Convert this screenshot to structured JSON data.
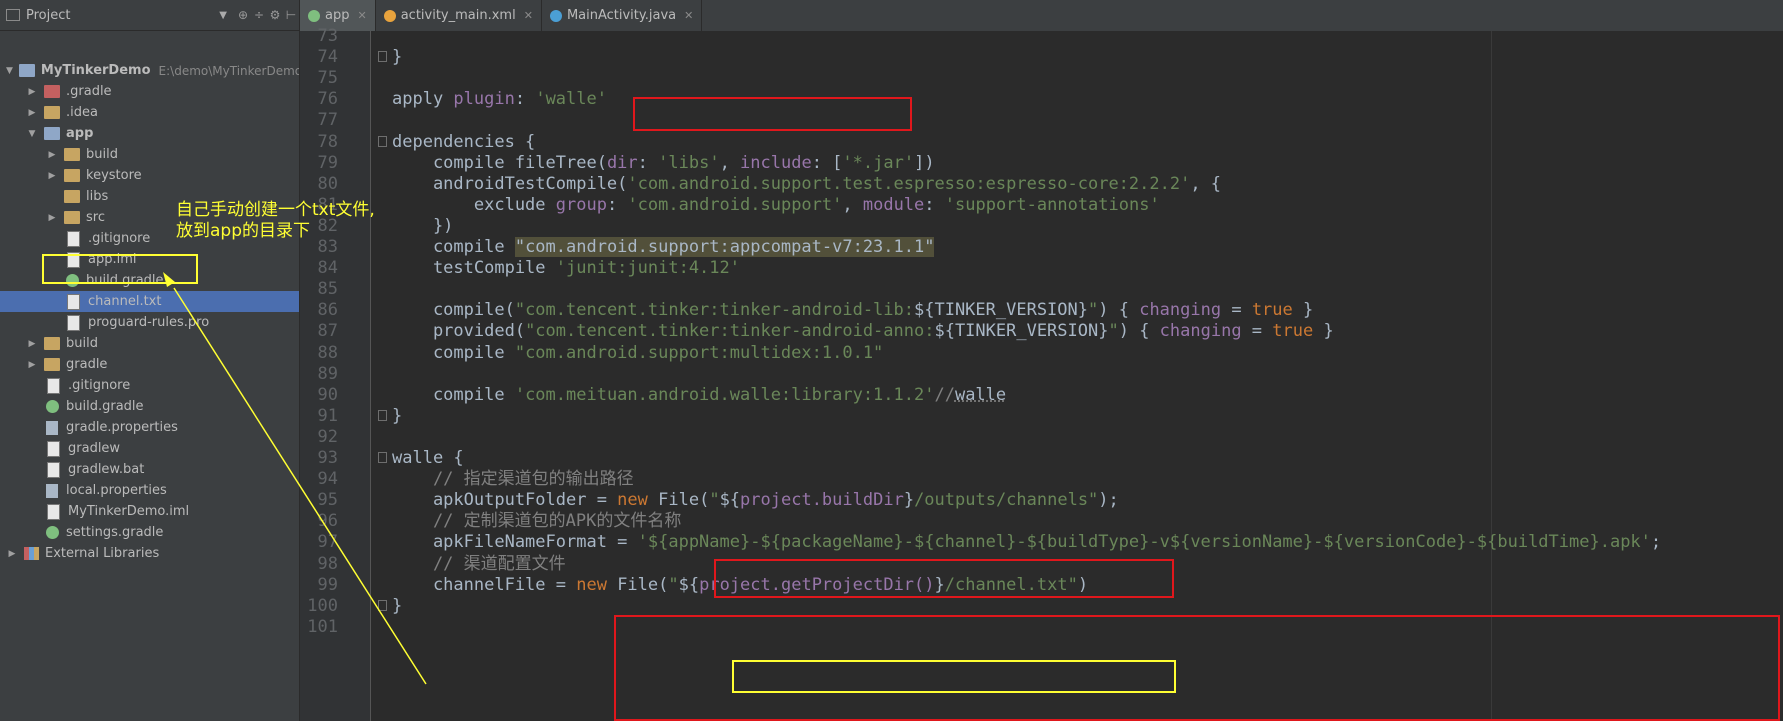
{
  "sidebar": {
    "header_label": "Project",
    "tree": [
      {
        "label": "MyTinkerDemo",
        "hint": "E:\\demo\\MyTinkerDemo",
        "depth": 0,
        "arrow": "open",
        "icon": "module-folder-icon",
        "bold": true
      },
      {
        "label": ".gradle",
        "depth": 1,
        "arrow": "closed",
        "icon": "excluded-folder-icon"
      },
      {
        "label": ".idea",
        "depth": 1,
        "arrow": "closed",
        "icon": "folder-icon"
      },
      {
        "label": "app",
        "depth": 1,
        "arrow": "open",
        "icon": "module-folder-icon",
        "bold": true
      },
      {
        "label": "build",
        "depth": 2,
        "arrow": "closed",
        "icon": "folder-icon"
      },
      {
        "label": "keystore",
        "depth": 2,
        "arrow": "closed",
        "icon": "folder-icon"
      },
      {
        "label": "libs",
        "depth": 2,
        "arrow": "none",
        "icon": "folder-icon"
      },
      {
        "label": "src",
        "depth": 2,
        "arrow": "closed",
        "icon": "folder-icon"
      },
      {
        "label": ".gitignore",
        "depth": 2,
        "arrow": "none",
        "icon": "file-icon"
      },
      {
        "label": "app.iml",
        "depth": 2,
        "arrow": "none",
        "icon": "file-icon"
      },
      {
        "label": "build.gradle",
        "depth": 2,
        "arrow": "none",
        "icon": "gradle-icon"
      },
      {
        "label": "channel.txt",
        "depth": 2,
        "arrow": "none",
        "icon": "file-icon",
        "selected": true
      },
      {
        "label": "proguard-rules.pro",
        "depth": 2,
        "arrow": "none",
        "icon": "file-icon"
      },
      {
        "label": "build",
        "depth": 1,
        "arrow": "closed",
        "icon": "folder-icon"
      },
      {
        "label": "gradle",
        "depth": 1,
        "arrow": "closed",
        "icon": "folder-icon"
      },
      {
        "label": ".gitignore",
        "depth": 1,
        "arrow": "none",
        "icon": "file-icon"
      },
      {
        "label": "build.gradle",
        "depth": 1,
        "arrow": "none",
        "icon": "gradle-icon"
      },
      {
        "label": "gradle.properties",
        "depth": 1,
        "arrow": "none",
        "icon": "properties-icon"
      },
      {
        "label": "gradlew",
        "depth": 1,
        "arrow": "none",
        "icon": "file-icon"
      },
      {
        "label": "gradlew.bat",
        "depth": 1,
        "arrow": "none",
        "icon": "file-icon"
      },
      {
        "label": "local.properties",
        "depth": 1,
        "arrow": "none",
        "icon": "properties-icon"
      },
      {
        "label": "MyTinkerDemo.iml",
        "depth": 1,
        "arrow": "none",
        "icon": "file-icon"
      },
      {
        "label": "settings.gradle",
        "depth": 1,
        "arrow": "none",
        "icon": "gradle-icon"
      },
      {
        "label": "External Libraries",
        "depth": 0,
        "arrow": "closed",
        "icon": "libraries-icon"
      }
    ]
  },
  "tabs": [
    {
      "label": "app",
      "icon_color": "#7fbf7f",
      "active": true
    },
    {
      "label": "activity_main.xml",
      "icon_color": "#e8a33d",
      "active": false
    },
    {
      "label": "MainActivity.java",
      "icon_color": "#4b9fd5",
      "active": false
    }
  ],
  "annotation_text": "自己手动创建一个txt文件,\n放到app的目录下",
  "code_lines": [
    {
      "n": "73",
      "fold": false,
      "parts": []
    },
    {
      "n": "74",
      "fold": true,
      "parts": [
        [
          "p",
          "}"
        ]
      ]
    },
    {
      "n": "75",
      "fold": false,
      "parts": []
    },
    {
      "n": "76",
      "fold": false,
      "parts": [
        [
          "p",
          "apply "
        ],
        [
          "prop",
          "plugin"
        ],
        [
          "p",
          ": "
        ],
        [
          "str",
          "'walle'"
        ]
      ]
    },
    {
      "n": "77",
      "fold": false,
      "parts": []
    },
    {
      "n": "78",
      "fold": true,
      "parts": [
        [
          "p",
          "dependencies {"
        ]
      ]
    },
    {
      "n": "79",
      "fold": false,
      "parts": [
        [
          "p",
          "    compile fileTree("
        ],
        [
          "prop",
          "dir"
        ],
        [
          "p",
          ": "
        ],
        [
          "str",
          "'libs'"
        ],
        [
          "p",
          ", "
        ],
        [
          "prop",
          "include"
        ],
        [
          "p",
          ": ["
        ],
        [
          "str",
          "'*.jar'"
        ],
        [
          "p",
          "])"
        ]
      ]
    },
    {
      "n": "80",
      "fold": false,
      "parts": [
        [
          "p",
          "    androidTestCompile("
        ],
        [
          "str",
          "'com.android.support.test.espresso:espresso-core:2.2.2'"
        ],
        [
          "p",
          ", {"
        ]
      ]
    },
    {
      "n": "81",
      "fold": false,
      "parts": [
        [
          "p",
          "        exclude "
        ],
        [
          "prop",
          "group"
        ],
        [
          "p",
          ": "
        ],
        [
          "str",
          "'com.android.support'"
        ],
        [
          "p",
          ", "
        ],
        [
          "prop",
          "module"
        ],
        [
          "p",
          ": "
        ],
        [
          "str",
          "'support-annotations'"
        ]
      ]
    },
    {
      "n": "82",
      "fold": false,
      "parts": [
        [
          "p",
          "    })"
        ]
      ]
    },
    {
      "n": "83",
      "fold": false,
      "parts": [
        [
          "p",
          "    compile "
        ],
        [
          "hl",
          "\"com.android.support:appcompat-v7:23.1.1\""
        ]
      ]
    },
    {
      "n": "84",
      "fold": false,
      "parts": [
        [
          "p",
          "    testCompile "
        ],
        [
          "str",
          "'junit:junit:4.12'"
        ]
      ]
    },
    {
      "n": "85",
      "fold": false,
      "parts": []
    },
    {
      "n": "86",
      "fold": false,
      "parts": [
        [
          "p",
          "    compile("
        ],
        [
          "str",
          "\"com.tencent.tinker:tinker-android-lib:"
        ],
        [
          "p",
          "${TINKER_VERSION}"
        ],
        [
          "str",
          "\""
        ],
        [
          "p",
          ") { "
        ],
        [
          "prop",
          "changing"
        ],
        [
          "p",
          " = "
        ],
        [
          "kw",
          "true"
        ],
        [
          "p",
          " }"
        ]
      ]
    },
    {
      "n": "87",
      "fold": false,
      "parts": [
        [
          "p",
          "    provided("
        ],
        [
          "str",
          "\"com.tencent.tinker:tinker-android-anno:"
        ],
        [
          "p",
          "${TINKER_VERSION}"
        ],
        [
          "str",
          "\""
        ],
        [
          "p",
          ") { "
        ],
        [
          "prop",
          "changing"
        ],
        [
          "p",
          " = "
        ],
        [
          "kw",
          "true"
        ],
        [
          "p",
          " }"
        ]
      ]
    },
    {
      "n": "88",
      "fold": false,
      "parts": [
        [
          "p",
          "    compile "
        ],
        [
          "str",
          "\"com.android.support:multidex:1.0.1\""
        ]
      ]
    },
    {
      "n": "89",
      "fold": false,
      "parts": []
    },
    {
      "n": "90",
      "fold": false,
      "parts": [
        [
          "p",
          "    compile "
        ],
        [
          "str",
          "'com.meituan.android.walle:library:1.1.2'"
        ],
        [
          "cmt",
          "//"
        ],
        [
          "wavy",
          "walle"
        ]
      ]
    },
    {
      "n": "91",
      "fold": true,
      "parts": [
        [
          "p",
          "}"
        ]
      ]
    },
    {
      "n": "92",
      "fold": false,
      "parts": []
    },
    {
      "n": "93",
      "fold": true,
      "parts": [
        [
          "p",
          "walle {"
        ]
      ]
    },
    {
      "n": "94",
      "fold": false,
      "parts": [
        [
          "cmt",
          "    // 指定渠道包的输出路径"
        ]
      ]
    },
    {
      "n": "95",
      "fold": false,
      "parts": [
        [
          "p",
          "    apkOutputFolder = "
        ],
        [
          "kw",
          "new "
        ],
        [
          "p",
          "File("
        ],
        [
          "str",
          "\""
        ],
        [
          "p",
          "${"
        ],
        [
          "ivar",
          "project.buildDir"
        ],
        [
          "p",
          "}"
        ],
        [
          "str",
          "/outputs/channels\""
        ],
        [
          "p",
          ");"
        ]
      ]
    },
    {
      "n": "96",
      "fold": false,
      "parts": [
        [
          "cmt",
          "    // 定制渠道包的APK的文件名称"
        ]
      ]
    },
    {
      "n": "97",
      "fold": false,
      "parts": [
        [
          "p",
          "    apkFileNameFormat = "
        ],
        [
          "str",
          "'${appName}-${packageName}-${channel}-${buildType}-v${versionName}-${versionCode}-${buildTime}.apk'"
        ],
        [
          "p",
          ";"
        ]
      ]
    },
    {
      "n": "98",
      "fold": false,
      "parts": [
        [
          "cmt",
          "    // 渠道配置文件"
        ]
      ]
    },
    {
      "n": "99",
      "fold": false,
      "parts": [
        [
          "p",
          "    channelFile = "
        ],
        [
          "kw",
          "new "
        ],
        [
          "p",
          "File("
        ],
        [
          "str",
          "\""
        ],
        [
          "p",
          "${"
        ],
        [
          "ivar",
          "project.getProjectDir()"
        ],
        [
          "p",
          "}"
        ],
        [
          "str",
          "/channel.txt\""
        ],
        [
          "p",
          ")"
        ]
      ]
    },
    {
      "n": "100",
      "fold": true,
      "parts": [
        [
          "p",
          "}"
        ]
      ]
    },
    {
      "n": "101",
      "fold": false,
      "parts": []
    }
  ]
}
